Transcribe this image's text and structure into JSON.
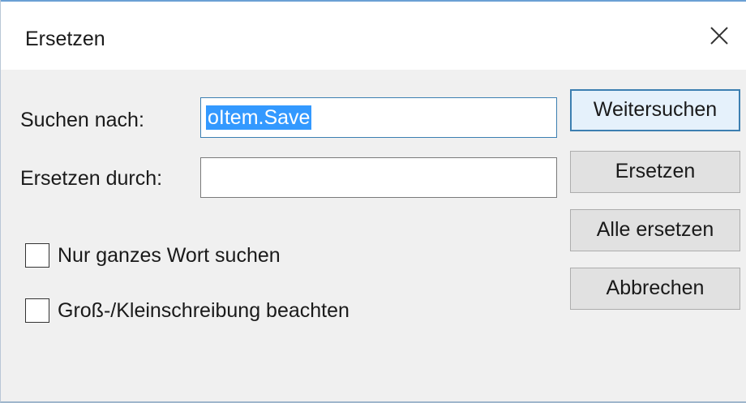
{
  "dialog": {
    "title": "Ersetzen",
    "close_icon": "close-icon"
  },
  "fields": {
    "search_label": "Suchen nach:",
    "search_value": "oItem.Save",
    "replace_label": "Ersetzen durch:",
    "replace_value": ""
  },
  "options": {
    "whole_word_label": "Nur ganzes Wort suchen",
    "whole_word_checked": false,
    "match_case_label": "Groß-/Kleinschreibung beachten",
    "match_case_checked": false
  },
  "buttons": {
    "find_next": "Weitersuchen",
    "replace": "Ersetzen",
    "replace_all": "Alle ersetzen",
    "cancel": "Abbrechen"
  },
  "colors": {
    "selection": "#3399ff",
    "focus_border": "#3c7fb1",
    "dialog_background": "#f0f0f0"
  }
}
